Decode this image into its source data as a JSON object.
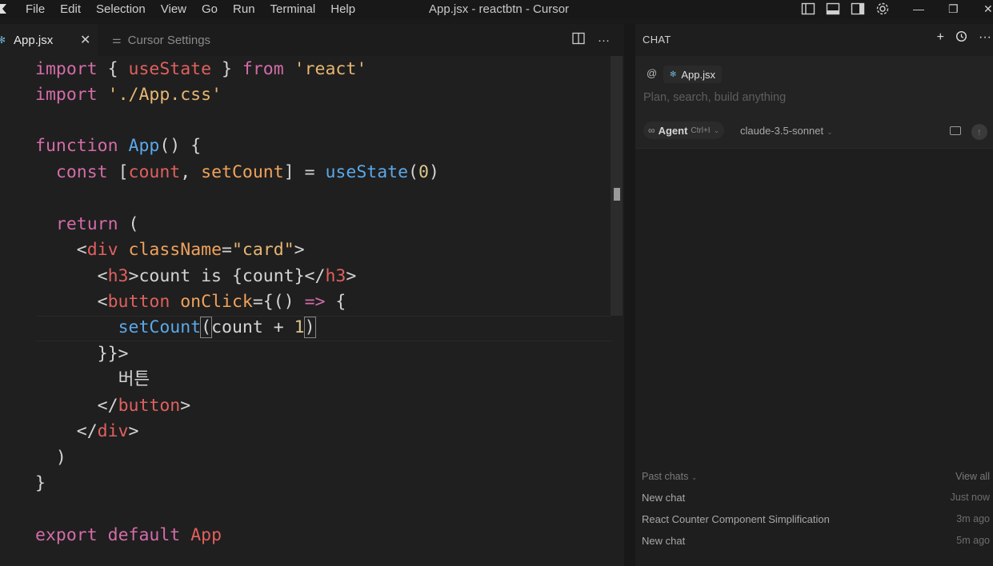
{
  "window": {
    "title": "App.jsx - reactbtn - Cursor"
  },
  "menu": [
    "File",
    "Edit",
    "Selection",
    "View",
    "Go",
    "Run",
    "Terminal",
    "Help"
  ],
  "tabs": [
    {
      "label": "App.jsx",
      "active": true,
      "close": "✕"
    },
    {
      "label": "Cursor Settings",
      "active": false
    }
  ],
  "editor": {
    "language": "jsx",
    "lines": [
      "import { useState } from 'react'",
      "import './App.css'",
      "",
      "function App() {",
      "  const [count, setCount] = useState(0)",
      "",
      "  return (",
      "    <div className=\"card\">",
      "      <h3>count is {count}</h3>",
      "      <button onClick={() => {",
      "        setCount(count + 1)",
      "      }}>",
      "        버튼",
      "      </button>",
      "    </div>",
      "  )",
      "}",
      "",
      "export default App"
    ]
  },
  "chat": {
    "title": "CHAT",
    "context_file": "App.jsx",
    "at_symbol": "@",
    "input_placeholder": "Plan, search, build anything",
    "mode": {
      "label": "Agent",
      "shortcut": "Ctrl+I"
    },
    "model": "claude-3.5-sonnet",
    "past_chats": {
      "header": "Past chats",
      "view_all": "View all",
      "items": [
        {
          "name": "New chat",
          "time": "Just now"
        },
        {
          "name": "React Counter Component Simplification",
          "time": "3m ago"
        },
        {
          "name": "New chat",
          "time": "5m ago"
        }
      ]
    }
  },
  "colors": {
    "keyword": "#d36ca8",
    "function": "#5ba8e8",
    "string": "#e6b673",
    "tag": "#e0605e",
    "attribute": "#f0a25c",
    "number": "#dcc68f",
    "editor_bg": "#1f1f1f"
  },
  "icons": [
    "cursor-logo-icon",
    "layout-sidebar-left-icon",
    "layout-panel-icon",
    "layout-sidebar-right-icon",
    "settings-gear-icon",
    "minimize-icon",
    "restore-icon",
    "close-icon",
    "split-editor-icon",
    "more-icon",
    "new-chat-plus-icon",
    "history-icon",
    "react-file-icon",
    "image-attach-icon",
    "send-arrow-icon"
  ]
}
